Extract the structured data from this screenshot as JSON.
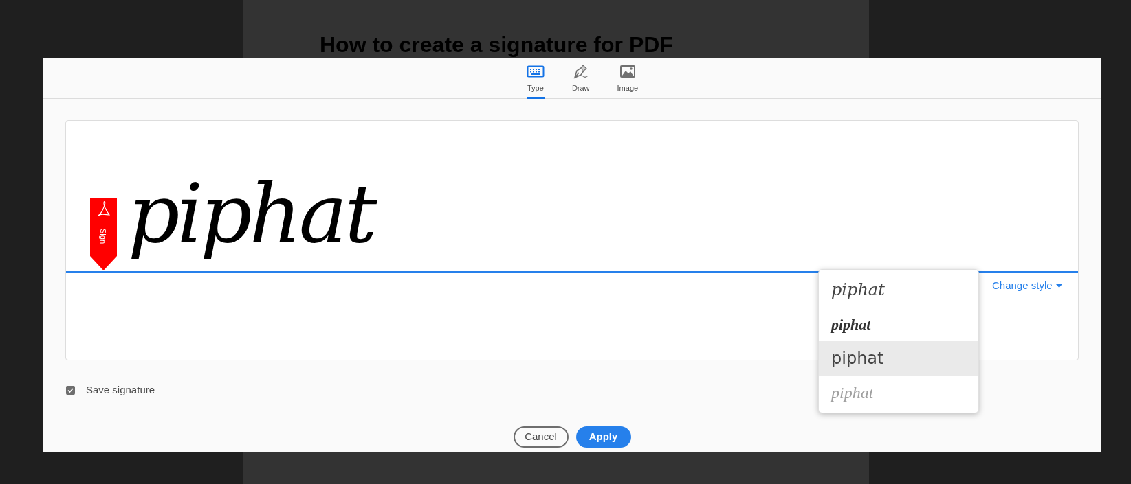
{
  "page": {
    "heading": "How to create a signature for PDF"
  },
  "dialog": {
    "tabs": [
      {
        "label": "Type",
        "kind": "keyboard",
        "selected": true
      },
      {
        "label": "Draw",
        "kind": "pen",
        "selected": false
      },
      {
        "label": "Image",
        "kind": "image",
        "selected": false
      }
    ],
    "badge": {
      "label": "Sign"
    },
    "signature": {
      "text": "piphat"
    },
    "change_style": {
      "label": "Change style"
    },
    "style_menu": [
      {
        "text": "piphat",
        "kind": "script",
        "selected": false
      },
      {
        "text": "piphat",
        "kind": "bold",
        "selected": false
      },
      {
        "text": "piphat",
        "kind": "print",
        "selected": true
      },
      {
        "text": "piphat",
        "kind": "light",
        "selected": false
      }
    ],
    "save_signature": {
      "label": "Save signature",
      "checked": true
    },
    "buttons": [
      {
        "label": "Cancel",
        "kind": "secondary"
      },
      {
        "label": "Apply",
        "kind": "primary"
      }
    ]
  }
}
